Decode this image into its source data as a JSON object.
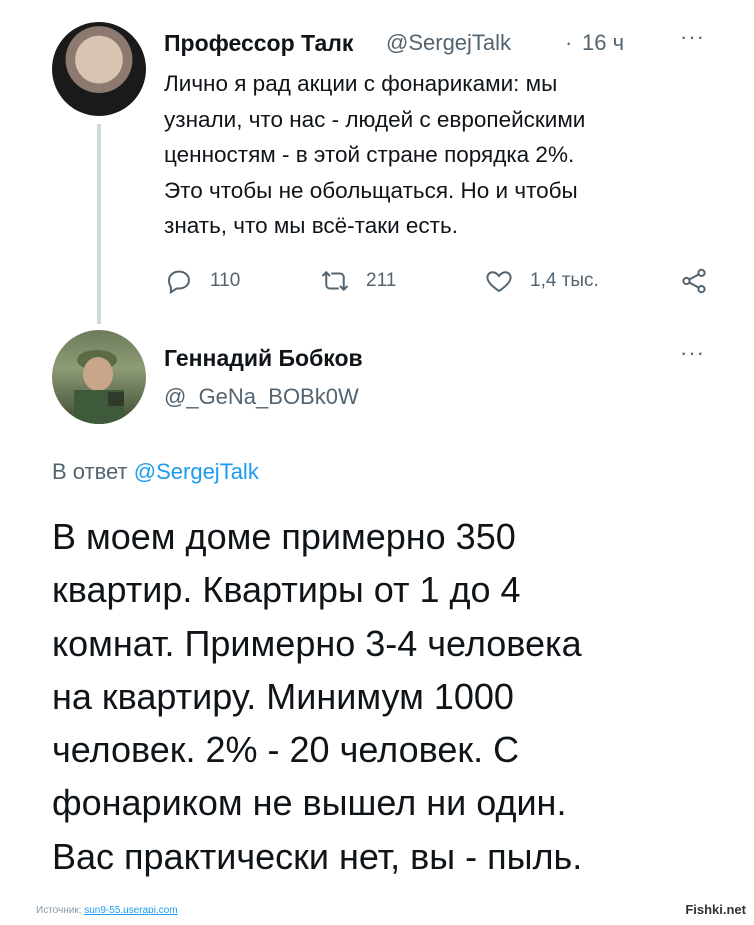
{
  "tweet1": {
    "author_name": "Профессор Талк",
    "handle": "@SergejTalk",
    "separator": "·",
    "time": "16 ч",
    "more": "···",
    "body_lines": [
      "Лично я рад акции с фонариками: мы",
      "узнали, что нас -  людей с европейскими",
      "ценностям - в этой стране порядка 2%.",
      "Это чтобы не обольщаться. Но и чтобы",
      "знать, что мы всё-таки есть."
    ],
    "actions": {
      "replies": "110",
      "retweets": "211",
      "likes": "1,4 тыс.",
      "reply_icon": "reply-icon",
      "retweet_icon": "retweet-icon",
      "like_icon": "heart-icon",
      "share_icon": "share-icon"
    }
  },
  "tweet2": {
    "author_name": "Геннадий Бобков",
    "handle": "@_GeNa_BOBk0W",
    "more": "···",
    "reply_prefix": "В ответ",
    "reply_to": "@SergejTalk",
    "body_lines": [
      "В моем доме примерно 350",
      "квартир. Квартиры от 1 до 4",
      "комнат. Примерно 3-4 человека",
      "на квартиру. Минимум 1000",
      "человек. 2% - 20 человек. С",
      "фонариком не вышел ни один.",
      "Вас практически нет, вы - пыль."
    ]
  },
  "footer": {
    "source_label": "Источник:",
    "source_link": "sun9-55.userapi.com",
    "brand": "Fishki.net"
  },
  "colors": {
    "text": "#0f1419",
    "secondary": "#536471",
    "link": "#1d9bf0",
    "thread_line": "#cfd9de"
  }
}
